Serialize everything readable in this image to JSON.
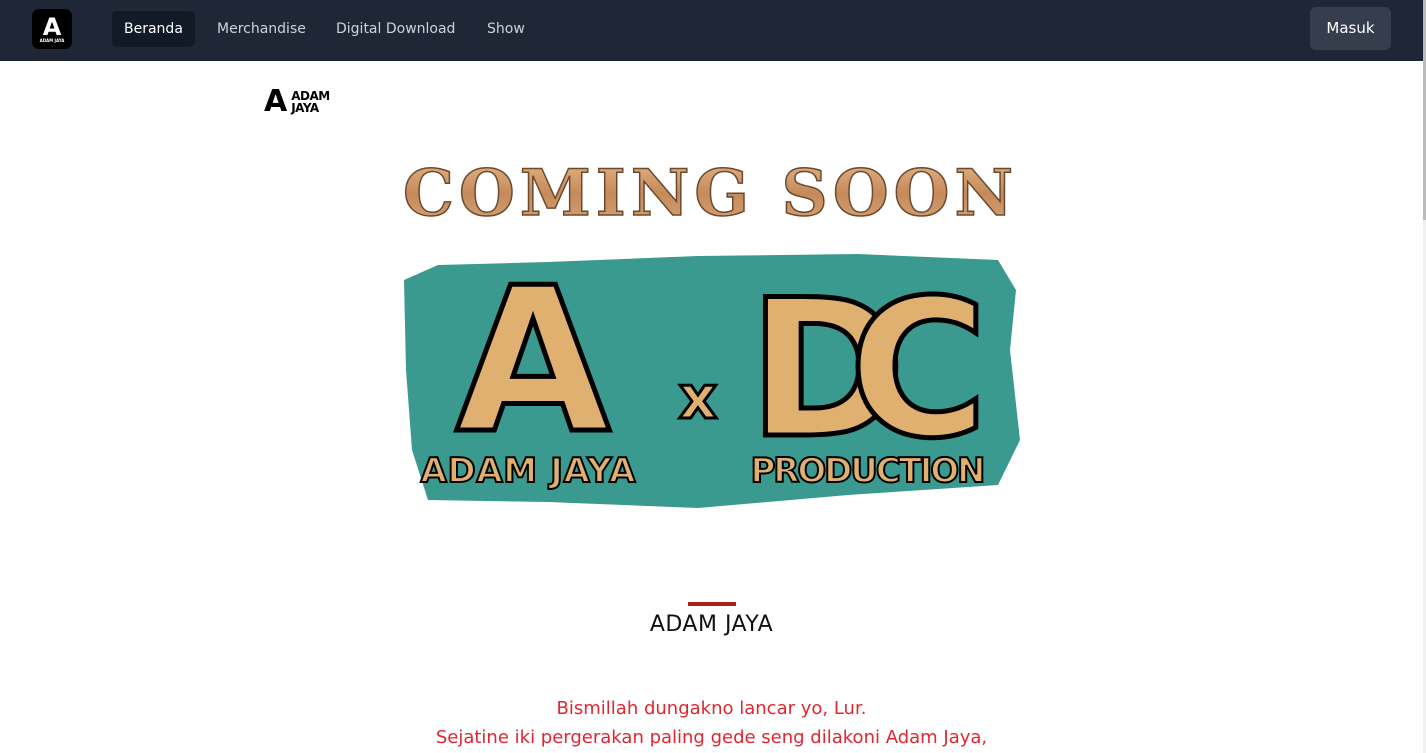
{
  "nav": {
    "logo_text": "ADAM JAYA",
    "items": [
      {
        "label": "Beranda",
        "active": true
      },
      {
        "label": "Merchandise"
      },
      {
        "label": "Digital Download"
      },
      {
        "label": "Show"
      }
    ],
    "login_label": "Masuk"
  },
  "brand": {
    "line1": "ADAM",
    "line2": "JAYA"
  },
  "banner": {
    "headline": "COMING SOON",
    "mark": "A",
    "x": "x",
    "dc": "DC",
    "left_caption": "ADAM JAYA",
    "right_caption": "PRODUCTION"
  },
  "section": {
    "title": "ADAM JAYA",
    "lines": [
      "Bismillah dungakno lancar yo, Lur.",
      "Sejatine iki pergerakan paling gede seng dilakoni Adam Jaya,"
    ]
  },
  "colors": {
    "nav": "#1f2737",
    "accent": "#b01c1c",
    "text_red": "#e0262f",
    "teal": "#3b9a8f",
    "tan": "#e0b071"
  }
}
